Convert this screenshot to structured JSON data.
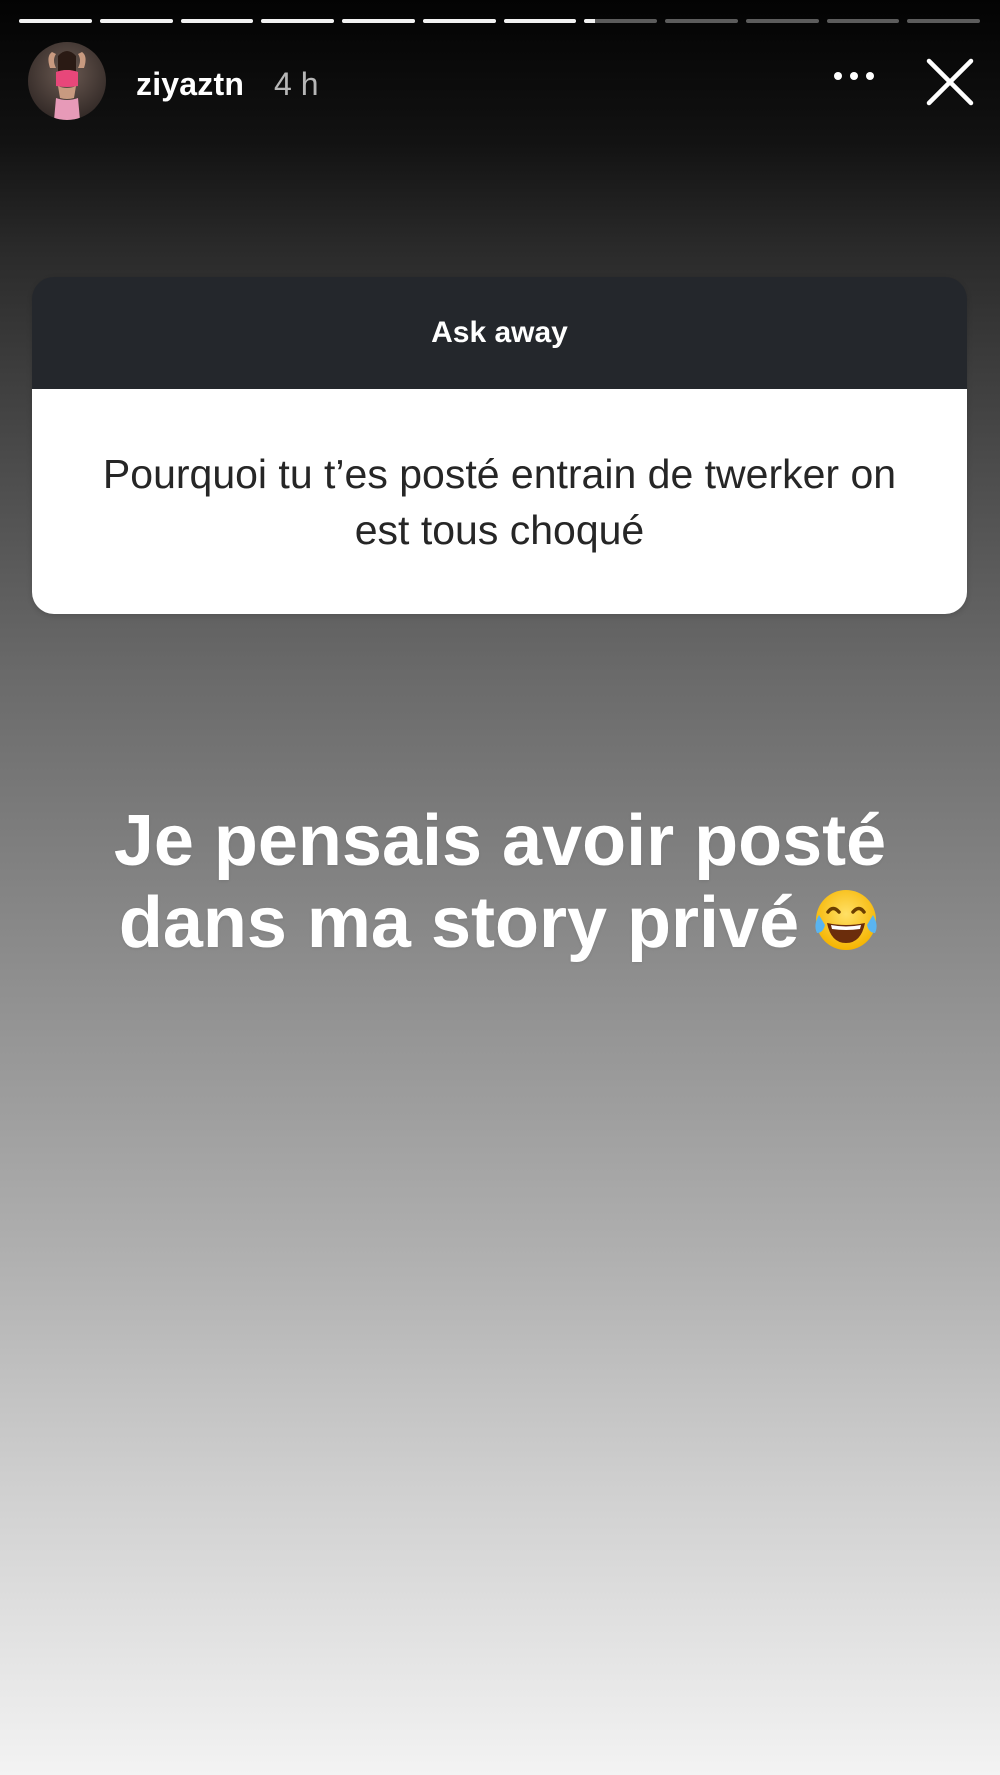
{
  "story": {
    "progress": {
      "segments_total": 12,
      "segments_viewed": 7,
      "current_segment_fraction": 0.15
    },
    "user": {
      "username": "ziyaztn",
      "time_ago": "4 h"
    },
    "icons": {
      "avatar": "profile-photo",
      "more": "more-horizontal-icon",
      "close": "close-icon",
      "emoji": "face-with-tears-of-joy-emoji"
    },
    "question_box": {
      "title": "Ask away",
      "question": "Pourquoi tu t’es posté entrain de twerker on est tous choqué"
    },
    "answer": {
      "line1": "Je pensais avoir posté",
      "line2": "dans ma story privé"
    },
    "colors": {
      "question_header": "#24272c",
      "question_body": "#ffffff",
      "answer_text": "#ffffff"
    }
  }
}
